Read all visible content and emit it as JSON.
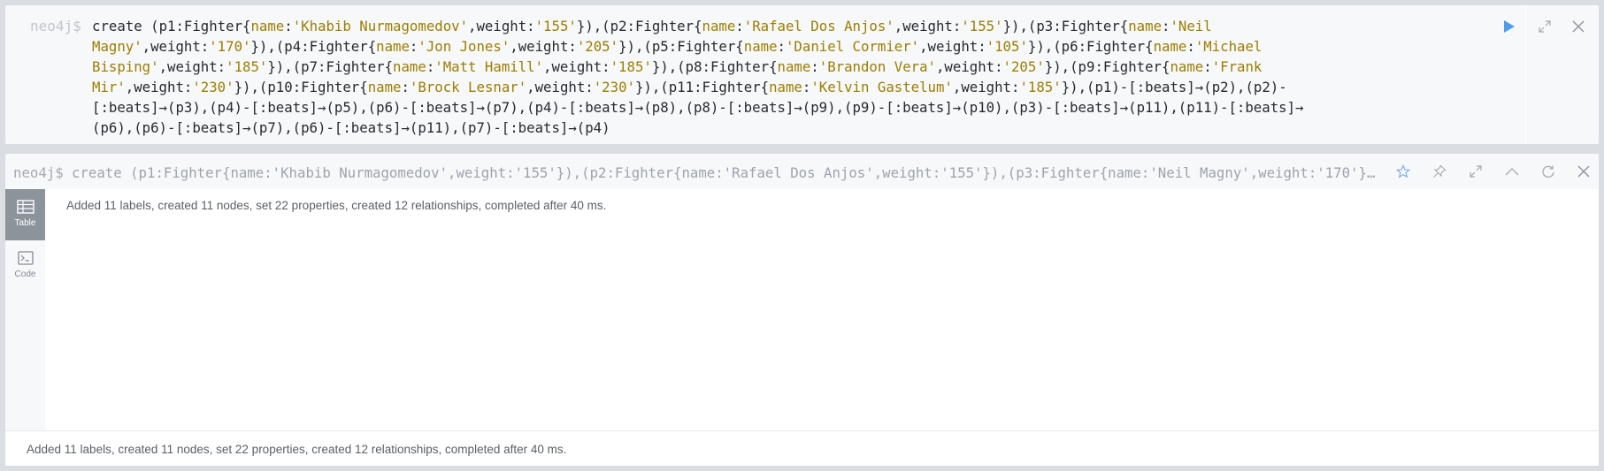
{
  "editor": {
    "prompt": "neo4j$",
    "lines": [
      [
        {
          "t": "create ",
          "c": "base"
        },
        {
          "t": "(p1:Fighter{",
          "c": "base"
        },
        {
          "t": "name",
          "c": "kw"
        },
        {
          "t": ":",
          "c": "base"
        },
        {
          "t": "'Khabib Nurmagomedov'",
          "c": "str"
        },
        {
          "t": ",weight:",
          "c": "base"
        },
        {
          "t": "'155'",
          "c": "str"
        },
        {
          "t": "}),(p2:Fighter{",
          "c": "base"
        },
        {
          "t": "name",
          "c": "kw"
        },
        {
          "t": ":",
          "c": "base"
        },
        {
          "t": "'Rafael Dos Anjos'",
          "c": "str"
        },
        {
          "t": ",weight:",
          "c": "base"
        },
        {
          "t": "'155'",
          "c": "str"
        },
        {
          "t": "}),(p3:Fighter{",
          "c": "base"
        },
        {
          "t": "name",
          "c": "kw"
        },
        {
          "t": ":",
          "c": "base"
        },
        {
          "t": "'Neil",
          "c": "str"
        }
      ],
      [
        {
          "t": "Magny'",
          "c": "str"
        },
        {
          "t": ",weight:",
          "c": "base"
        },
        {
          "t": "'170'",
          "c": "str"
        },
        {
          "t": "}),(p4:Fighter{",
          "c": "base"
        },
        {
          "t": "name",
          "c": "kw"
        },
        {
          "t": ":",
          "c": "base"
        },
        {
          "t": "'Jon Jones'",
          "c": "str"
        },
        {
          "t": ",weight:",
          "c": "base"
        },
        {
          "t": "'205'",
          "c": "str"
        },
        {
          "t": "}),(p5:Fighter{",
          "c": "base"
        },
        {
          "t": "name",
          "c": "kw"
        },
        {
          "t": ":",
          "c": "base"
        },
        {
          "t": "'Daniel Cormier'",
          "c": "str"
        },
        {
          "t": ",weight:",
          "c": "base"
        },
        {
          "t": "'105'",
          "c": "str"
        },
        {
          "t": "}),(p6:Fighter{",
          "c": "base"
        },
        {
          "t": "name",
          "c": "kw"
        },
        {
          "t": ":",
          "c": "base"
        },
        {
          "t": "'Michael",
          "c": "str"
        }
      ],
      [
        {
          "t": "Bisping'",
          "c": "str"
        },
        {
          "t": ",weight:",
          "c": "base"
        },
        {
          "t": "'185'",
          "c": "str"
        },
        {
          "t": "}),(p7:Fighter{",
          "c": "base"
        },
        {
          "t": "name",
          "c": "kw"
        },
        {
          "t": ":",
          "c": "base"
        },
        {
          "t": "'Matt Hamill'",
          "c": "str"
        },
        {
          "t": ",weight:",
          "c": "base"
        },
        {
          "t": "'185'",
          "c": "str"
        },
        {
          "t": "}),(p8:Fighter{",
          "c": "base"
        },
        {
          "t": "name",
          "c": "kw"
        },
        {
          "t": ":",
          "c": "base"
        },
        {
          "t": "'Brandon Vera'",
          "c": "str"
        },
        {
          "t": ",weight:",
          "c": "base"
        },
        {
          "t": "'205'",
          "c": "str"
        },
        {
          "t": "}),(p9:Fighter{",
          "c": "base"
        },
        {
          "t": "name",
          "c": "kw"
        },
        {
          "t": ":",
          "c": "base"
        },
        {
          "t": "'Frank",
          "c": "str"
        }
      ],
      [
        {
          "t": "Mir'",
          "c": "str"
        },
        {
          "t": ",weight:",
          "c": "base"
        },
        {
          "t": "'230'",
          "c": "str"
        },
        {
          "t": "}),(p10:Fighter{",
          "c": "base"
        },
        {
          "t": "name",
          "c": "kw"
        },
        {
          "t": ":",
          "c": "base"
        },
        {
          "t": "'Brock Lesnar'",
          "c": "str"
        },
        {
          "t": ",weight:",
          "c": "base"
        },
        {
          "t": "'230'",
          "c": "str"
        },
        {
          "t": "}),(p11:Fighter{",
          "c": "base"
        },
        {
          "t": "name",
          "c": "kw"
        },
        {
          "t": ":",
          "c": "base"
        },
        {
          "t": "'Kelvin Gastelum'",
          "c": "str"
        },
        {
          "t": ",weight:",
          "c": "base"
        },
        {
          "t": "'185'",
          "c": "str"
        },
        {
          "t": "}),(p1)-[:beats]→(p2),(p2)-",
          "c": "base"
        }
      ],
      [
        {
          "t": "[:beats]→(p3),(p4)-[:beats]→(p5),(p6)-[:beats]→(p7),(p4)-[:beats]→(p8),(p8)-[:beats]→(p9),(p9)-[:beats]→(p10),(p3)-[:beats]→(p11),(p11)-[:beats]→",
          "c": "base"
        }
      ],
      [
        {
          "t": "(p6),(p6)-[:beats]→(p7),(p6)-[:beats]→(p11),(p7)-[:beats]→(p4)",
          "c": "base"
        }
      ]
    ]
  },
  "frame": {
    "prompt": "neo4j$",
    "query": "create (p1:Fighter{name:'Khabib Nurmagomedov',weight:'155'}),(p2:Fighter{name:'Rafael Dos Anjos',weight:'155'}),(p3:Fighter{name:'Neil Magny',weight:'170'})…",
    "sidebar": {
      "table_label": "Table",
      "code_label": "Code"
    },
    "result_message": "Added 11 labels, created 11 nodes, set 22 properties, created 12 relationships, completed after 40 ms.",
    "status_message": "Added 11 labels, created 11 nodes, set 22 properties, created 12 relationships, completed after 40 ms."
  },
  "icons": {
    "run": "play-icon",
    "expand": "expand-icon",
    "close": "close-icon",
    "star": "star-icon",
    "pin": "pin-icon",
    "collapse": "chevron-up-icon",
    "rerun": "rerun-icon",
    "table": "table-icon",
    "code": "code-terminal-icon"
  },
  "colors": {
    "accent": "#4c9ee8",
    "keyword": "#9c7d00",
    "sidebar_active": "#8d939b"
  }
}
